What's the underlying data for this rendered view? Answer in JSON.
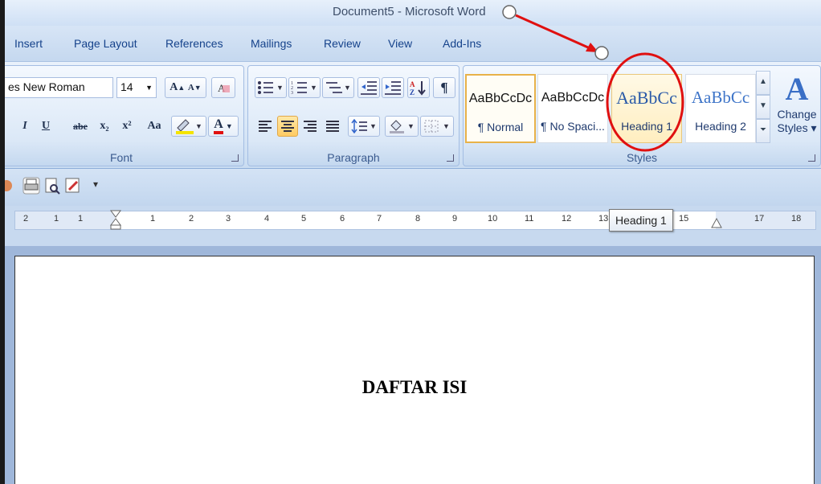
{
  "window": {
    "title": "Document5 - Microsoft Word"
  },
  "tabs": [
    {
      "label": "Insert"
    },
    {
      "label": "Page Layout"
    },
    {
      "label": "References"
    },
    {
      "label": "Mailings"
    },
    {
      "label": "Review"
    },
    {
      "label": "View"
    },
    {
      "label": "Add-Ins"
    }
  ],
  "font_group": {
    "label": "Font",
    "font_name": "es New Roman",
    "font_size": "14",
    "grow_label": "A",
    "shrink_label": "A",
    "italic_label": "I",
    "underline_label": "U",
    "strike_label": "abe",
    "subscript_label": "x₂",
    "superscript_label": "x²",
    "case_label": "Aa",
    "color_label": "A"
  },
  "paragraph_group": {
    "label": "Paragraph",
    "pilcrow": "¶"
  },
  "styles_group": {
    "label": "Styles",
    "items": [
      {
        "sample": "AaBbCcDc",
        "name": "¶ Normal"
      },
      {
        "sample": "AaBbCcDc",
        "name": "¶ No Spaci..."
      },
      {
        "sample": "AaBbCc",
        "name": "Heading 1"
      },
      {
        "sample": "AaBbCc",
        "name": "Heading 2"
      }
    ],
    "change_styles_label_1": "Change",
    "change_styles_label_2": "Styles ▾"
  },
  "ruler": {
    "numbers": [
      "2",
      "1",
      "1",
      "1",
      "2",
      "3",
      "4",
      "5",
      "6",
      "7",
      "8",
      "9",
      "10",
      "11",
      "12",
      "13",
      "15",
      "17",
      "18"
    ],
    "tooltip": "Heading 1"
  },
  "document": {
    "heading": "DAFTAR ISI"
  },
  "colors": {
    "annotation": "#e01010",
    "accent_selected": "#ffcb63"
  }
}
